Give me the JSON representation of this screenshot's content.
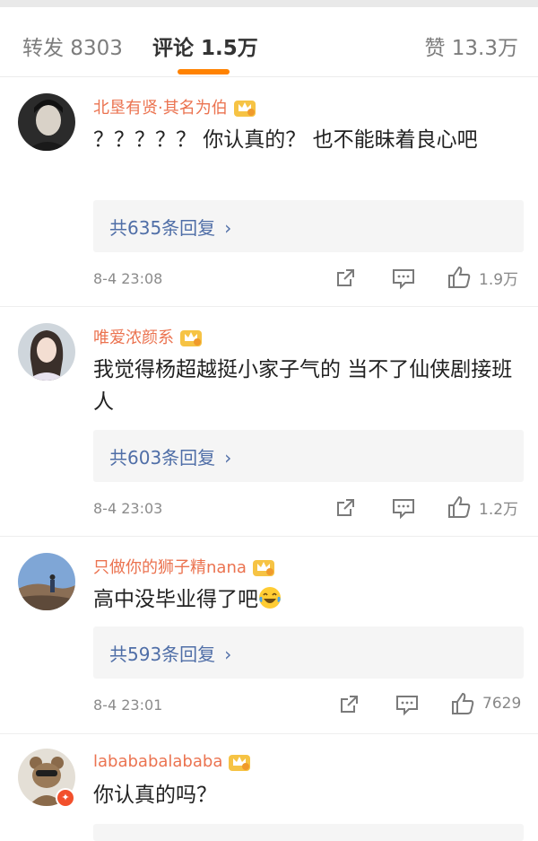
{
  "tabs": {
    "repost": "转发 8303",
    "comment": "评论 1.5万",
    "like": "赞 13.3万",
    "accent": "#ff8200"
  },
  "comments": [
    {
      "username": "北垦有贤·其名为伯",
      "text": "？？？？？ 你认真的？ 也不能昧着良心吧",
      "replies": "共635条回复",
      "time": "8-4 23:08",
      "likes": "1.9万"
    },
    {
      "username": "唯爱浓颜系",
      "text": "我觉得杨超越挺小家子气的 当不了仙侠剧接班人",
      "replies": "共603条回复",
      "time": "8-4 23:03",
      "likes": "1.2万"
    },
    {
      "username": "只做你的狮子精nana",
      "text": "高中没毕业得了吧",
      "replies": "共593条回复",
      "time": "8-4 23:01",
      "likes": "7629"
    },
    {
      "username": "labababalababa",
      "text": "你认真的吗？"
    }
  ],
  "icons": {
    "reply_chevron": "chevron-right-icon",
    "share": "share-icon",
    "comment": "comment-icon",
    "like": "thumbs-up-icon",
    "crown": "crown-badge-icon",
    "laugh_emoji": "laughing-crying-emoji"
  },
  "colors": {
    "username": "#eb7350",
    "reply_link": "#4f6ea7",
    "badge": "#f2502c"
  }
}
